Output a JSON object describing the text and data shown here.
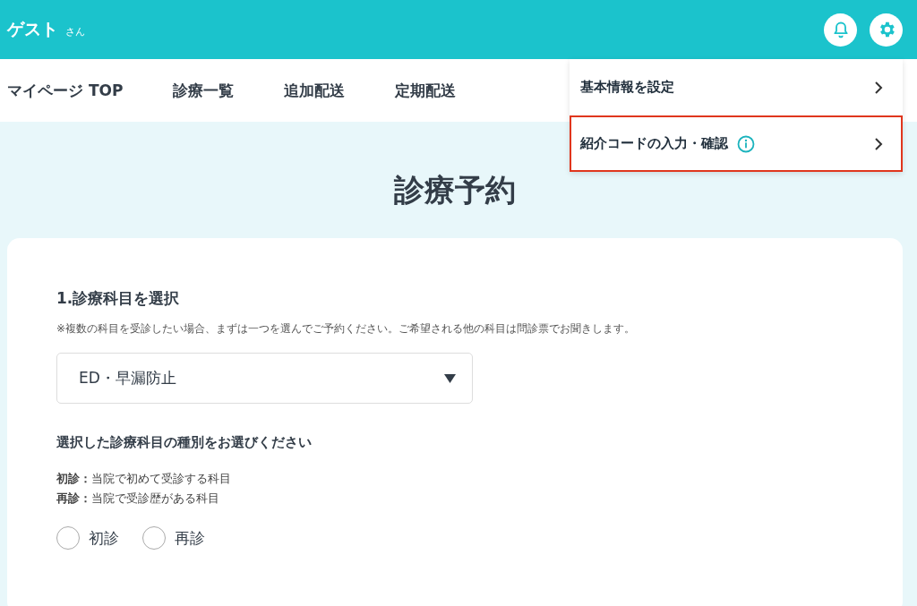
{
  "header": {
    "user_name": "ゲスト",
    "honorific": "さん"
  },
  "nav": [
    {
      "label": "マイページ TOP"
    },
    {
      "label": "診療一覧"
    },
    {
      "label": "追加配送"
    },
    {
      "label": "定期配送"
    }
  ],
  "settings_menu": {
    "items": [
      {
        "label": "基本情報を設定",
        "info": false,
        "selected": false
      },
      {
        "label": "紹介コードの入力・確認",
        "info": true,
        "selected": true
      }
    ]
  },
  "page_title": "診療予約",
  "form": {
    "step_title": "1.診療科目を選択",
    "note": "※複数の科目を受診したい場合、まずは一つを選んでご予約ください。ご希望される他の科目は問診票でお聞きします。",
    "department_select": {
      "value": "ED・早漏防止"
    },
    "type_title": "選択した診療科目の種別をお選びください",
    "definitions": [
      "**初診：**当院で初めて受診する科目",
      "**再診：**当院で受診歴がある科目"
    ],
    "visit_types": [
      {
        "label": "初診",
        "selected": false
      },
      {
        "label": "再診",
        "selected": false
      }
    ]
  }
}
